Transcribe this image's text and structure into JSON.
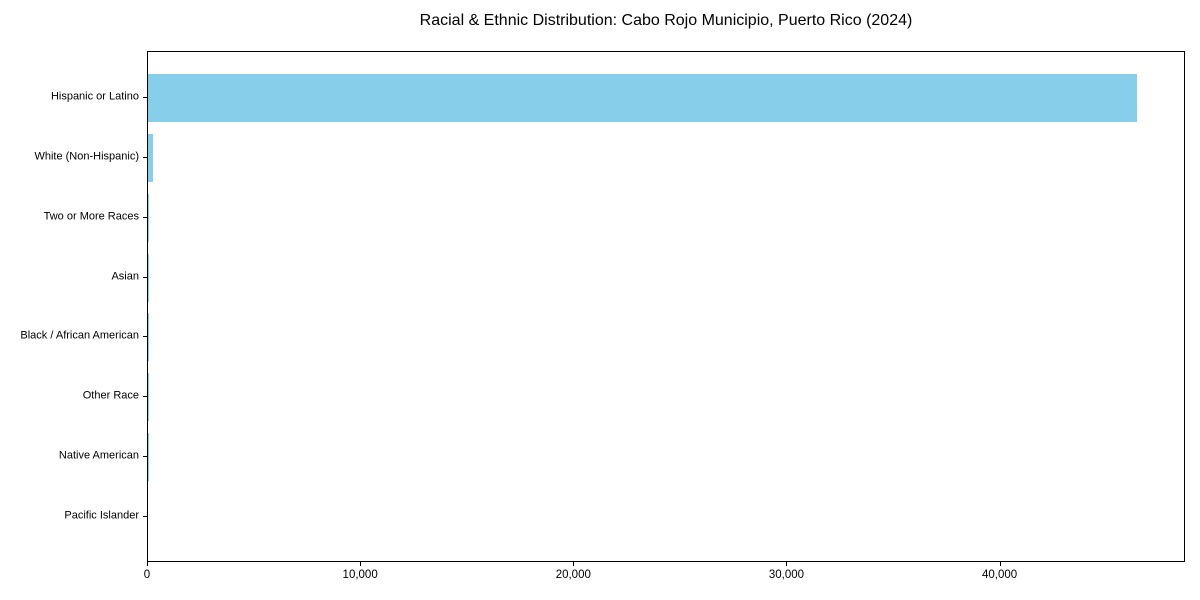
{
  "chart_data": {
    "type": "bar",
    "orientation": "horizontal",
    "title": "Racial & Ethnic Distribution: Cabo Rojo Municipio, Puerto Rico (2024)",
    "xlabel": "",
    "ylabel": "",
    "categories": [
      "Hispanic or Latino",
      "White (Non-Hispanic)",
      "Two or More Races",
      "Asian",
      "Black / African American",
      "Other Race",
      "Native American",
      "Pacific Islander"
    ],
    "values": [
      46400,
      240,
      50,
      30,
      15,
      10,
      5,
      2
    ],
    "xlim": [
      0,
      48700
    ],
    "xticks": {
      "values": [
        0,
        10000,
        20000,
        30000,
        40000
      ],
      "labels": [
        "0",
        "10,000",
        "20,000",
        "30,000",
        "40,000"
      ]
    },
    "grid": false,
    "legend": null,
    "bar_color": "#87CEEB",
    "background_color": "#ffffff",
    "axis_color": "#000000"
  }
}
